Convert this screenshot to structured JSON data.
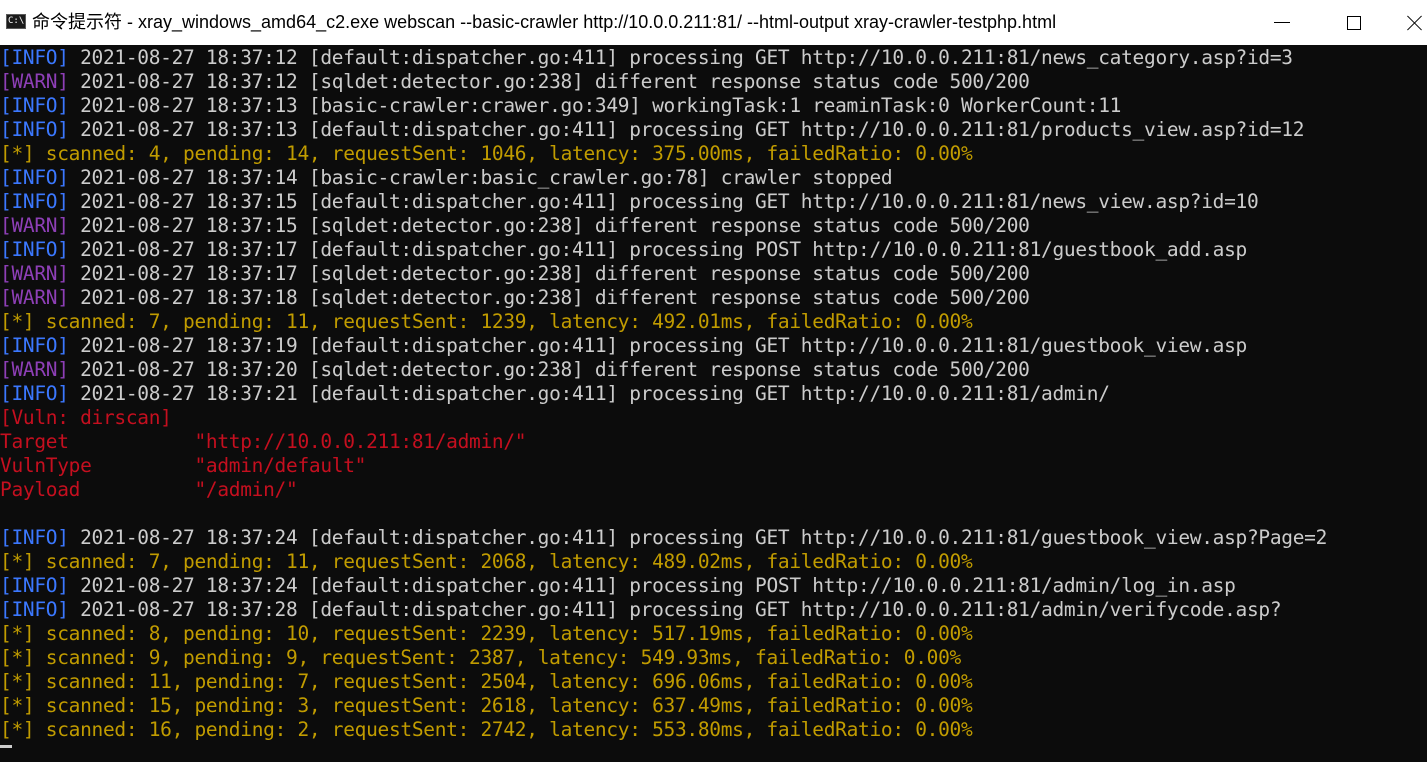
{
  "window": {
    "title": "命令提示符 - xray_windows_amd64_c2.exe  webscan --basic-crawler http://10.0.0.211:81/ --html-output xray-crawler-testphp.html",
    "icon_text": "C:\\."
  },
  "colors": {
    "background": "#0c0c0c",
    "info": "#3b78ff",
    "warn": "#8e3fb7",
    "status": "#c19c00",
    "text": "#cccccc",
    "vuln": "#c50f1f"
  },
  "console": {
    "lines": [
      {
        "kind": "info",
        "tag": "[INFO]",
        "text": " 2021-08-27 18:37:12 [default:dispatcher.go:411] processing GET http://10.0.0.211:81/news_category.asp?id=3"
      },
      {
        "kind": "warn",
        "tag": "[WARN]",
        "text": " 2021-08-27 18:37:12 [sqldet:detector.go:238] different response status code 500/200"
      },
      {
        "kind": "info",
        "tag": "[INFO]",
        "text": " 2021-08-27 18:37:13 [basic-crawler:crawer.go:349] workingTask:1 reaminTask:0 WorkerCount:11"
      },
      {
        "kind": "info",
        "tag": "[INFO]",
        "text": " 2021-08-27 18:37:13 [default:dispatcher.go:411] processing GET http://10.0.0.211:81/products_view.asp?id=12"
      },
      {
        "kind": "star",
        "tag": "[*]",
        "text": " scanned: 4, pending: 14, requestSent: 1046, latency: 375.00ms, failedRatio: 0.00%"
      },
      {
        "kind": "info",
        "tag": "[INFO]",
        "text": " 2021-08-27 18:37:14 [basic-crawler:basic_crawler.go:78] crawler stopped"
      },
      {
        "kind": "info",
        "tag": "[INFO]",
        "text": " 2021-08-27 18:37:15 [default:dispatcher.go:411] processing GET http://10.0.0.211:81/news_view.asp?id=10"
      },
      {
        "kind": "warn",
        "tag": "[WARN]",
        "text": " 2021-08-27 18:37:15 [sqldet:detector.go:238] different response status code 500/200"
      },
      {
        "kind": "info",
        "tag": "[INFO]",
        "text": " 2021-08-27 18:37:17 [default:dispatcher.go:411] processing POST http://10.0.0.211:81/guestbook_add.asp"
      },
      {
        "kind": "warn",
        "tag": "[WARN]",
        "text": " 2021-08-27 18:37:17 [sqldet:detector.go:238] different response status code 500/200"
      },
      {
        "kind": "warn",
        "tag": "[WARN]",
        "text": " 2021-08-27 18:37:18 [sqldet:detector.go:238] different response status code 500/200"
      },
      {
        "kind": "star",
        "tag": "[*]",
        "text": " scanned: 7, pending: 11, requestSent: 1239, latency: 492.01ms, failedRatio: 0.00%"
      },
      {
        "kind": "info",
        "tag": "[INFO]",
        "text": " 2021-08-27 18:37:19 [default:dispatcher.go:411] processing GET http://10.0.0.211:81/guestbook_view.asp"
      },
      {
        "kind": "warn",
        "tag": "[WARN]",
        "text": " 2021-08-27 18:37:20 [sqldet:detector.go:238] different response status code 500/200"
      },
      {
        "kind": "info",
        "tag": "[INFO]",
        "text": " 2021-08-27 18:37:21 [default:dispatcher.go:411] processing GET http://10.0.0.211:81/admin/"
      },
      {
        "kind": "vuln",
        "tag": "",
        "text": "[Vuln: dirscan]"
      },
      {
        "kind": "vuln",
        "tag": "",
        "text": "Target           \"http://10.0.0.211:81/admin/\""
      },
      {
        "kind": "vuln",
        "tag": "",
        "text": "VulnType         \"admin/default\""
      },
      {
        "kind": "vuln",
        "tag": "",
        "text": "Payload          \"/admin/\""
      },
      {
        "kind": "blank",
        "tag": "",
        "text": ""
      },
      {
        "kind": "info",
        "tag": "[INFO]",
        "text": " 2021-08-27 18:37:24 [default:dispatcher.go:411] processing GET http://10.0.0.211:81/guestbook_view.asp?Page=2"
      },
      {
        "kind": "star",
        "tag": "[*]",
        "text": " scanned: 7, pending: 11, requestSent: 2068, latency: 489.02ms, failedRatio: 0.00%"
      },
      {
        "kind": "info",
        "tag": "[INFO]",
        "text": " 2021-08-27 18:37:24 [default:dispatcher.go:411] processing POST http://10.0.0.211:81/admin/log_in.asp"
      },
      {
        "kind": "info",
        "tag": "[INFO]",
        "text": " 2021-08-27 18:37:28 [default:dispatcher.go:411] processing GET http://10.0.0.211:81/admin/verifycode.asp?"
      },
      {
        "kind": "star",
        "tag": "[*]",
        "text": " scanned: 8, pending: 10, requestSent: 2239, latency: 517.19ms, failedRatio: 0.00%"
      },
      {
        "kind": "star",
        "tag": "[*]",
        "text": " scanned: 9, pending: 9, requestSent: 2387, latency: 549.93ms, failedRatio: 0.00%"
      },
      {
        "kind": "star",
        "tag": "[*]",
        "text": " scanned: 11, pending: 7, requestSent: 2504, latency: 696.06ms, failedRatio: 0.00%"
      },
      {
        "kind": "star",
        "tag": "[*]",
        "text": " scanned: 15, pending: 3, requestSent: 2618, latency: 637.49ms, failedRatio: 0.00%"
      },
      {
        "kind": "star",
        "tag": "[*]",
        "text": " scanned: 16, pending: 2, requestSent: 2742, latency: 553.80ms, failedRatio: 0.00%"
      }
    ]
  }
}
